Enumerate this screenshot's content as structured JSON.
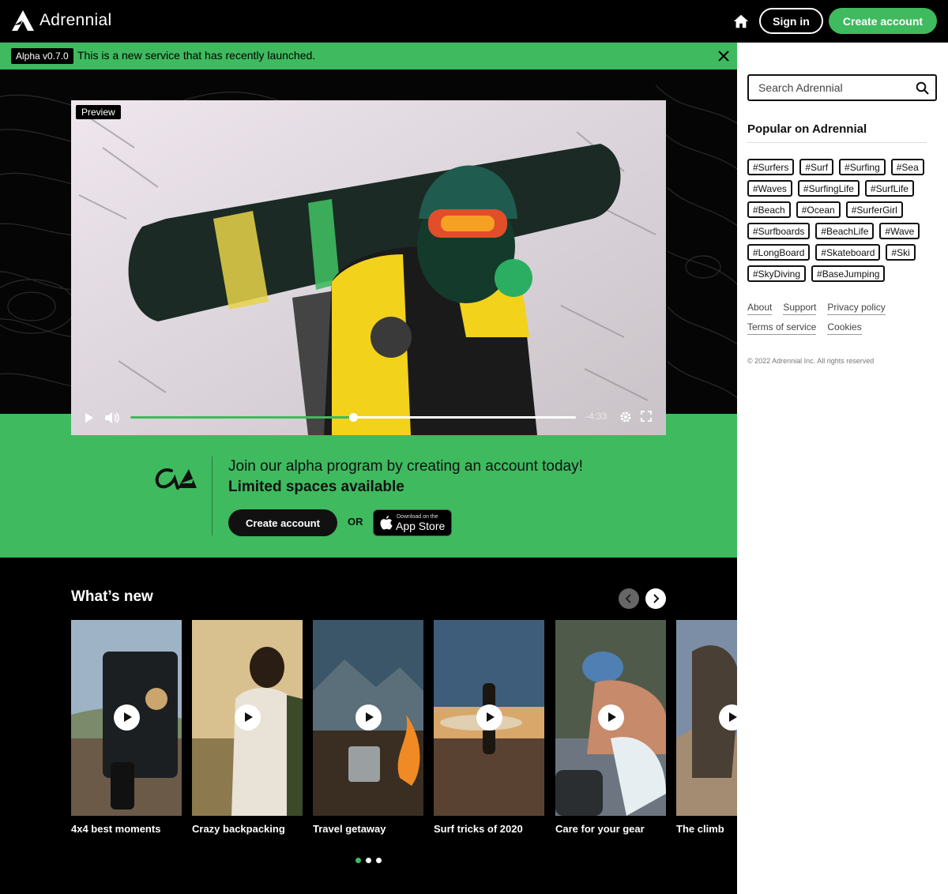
{
  "brand": {
    "name": "Adrennial",
    "accent": "#3fba5f"
  },
  "header": {
    "sign_in": "Sign in",
    "create_account": "Create account"
  },
  "banner": {
    "tag": "Alpha v0.7.0",
    "message": "This is a new service that has recently launched."
  },
  "video": {
    "badge": "Preview",
    "time_remaining": "-4:33",
    "progress": 0.5
  },
  "join": {
    "text_regular": "Join our alpha program by creating an account today! ",
    "text_bold": "Limited spaces available",
    "create_account": "Create account",
    "or": "OR",
    "appstore_small": "Download on the",
    "appstore_big": "App Store"
  },
  "whats_new": {
    "title": "What’s new",
    "cards": [
      {
        "title": "4x4 best moments"
      },
      {
        "title": "Crazy backpacking"
      },
      {
        "title": "Travel getaway"
      },
      {
        "title": "Surf tricks of 2020"
      },
      {
        "title": "Care for your gear"
      },
      {
        "title": "The climb"
      }
    ],
    "pages": 3,
    "active_page": 1
  },
  "sidebar": {
    "search_placeholder": "Search Adrennial",
    "popular_title": "Popular on Adrennial",
    "tags": [
      "#Surfers",
      "#Surf",
      "#Surfing",
      "#Sea",
      "#Waves",
      "#SurfingLife",
      "#SurfLife",
      "#Beach",
      "#Ocean",
      "#SurferGirl",
      "#Surfboards",
      "#BeachLife",
      "#Wave",
      "#LongBoard",
      "#Skateboard",
      "#Ski",
      "#SkyDiving",
      "#BaseJumping"
    ],
    "links": [
      "About",
      "Support",
      "Privacy policy",
      "Terms of service",
      "Cookies"
    ],
    "copyright": "© 2022 Adrennial Inc. All rights reserved"
  }
}
